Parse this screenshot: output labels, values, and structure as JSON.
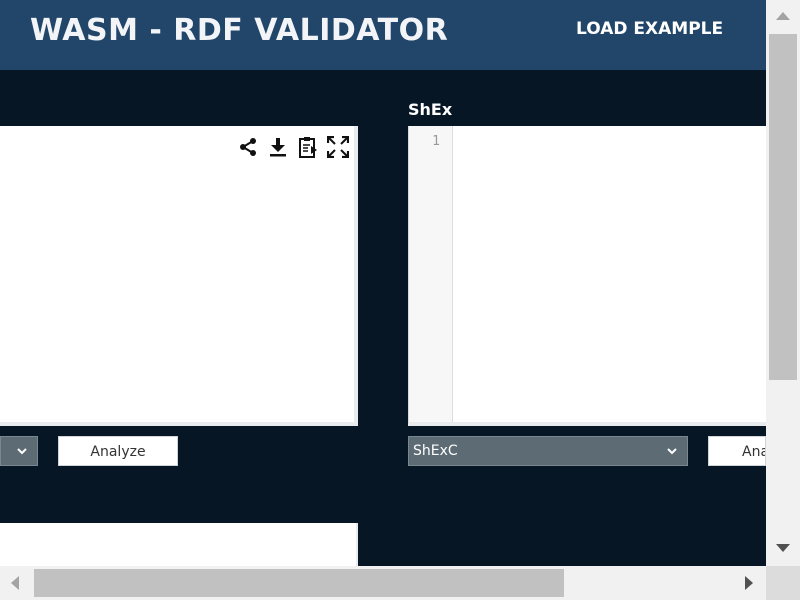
{
  "header": {
    "title": "WASM - RDF VALIDATOR",
    "load_example_label": "LOAD EXAMPLE"
  },
  "left_panel": {
    "toolbar_icons": [
      "share-icon",
      "download-icon",
      "paste-icon",
      "fullscreen-icon"
    ],
    "analyze_label": "Analyze"
  },
  "right_panel": {
    "label": "ShEx",
    "line_number": "1",
    "format_selected": "ShExC",
    "analyze_label": "Analyze"
  },
  "colors": {
    "header_bg": "#22466a",
    "page_bg": "#061624",
    "select_bg": "#5d6b74"
  }
}
